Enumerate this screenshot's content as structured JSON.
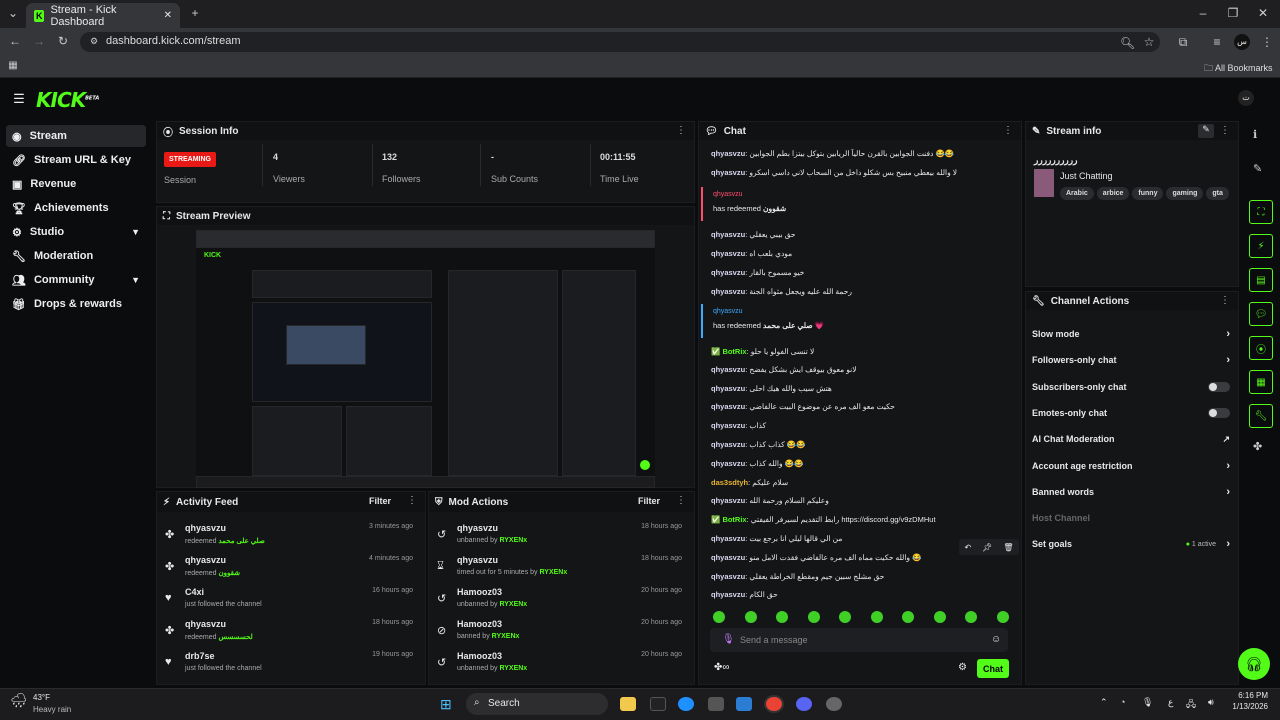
{
  "browser": {
    "tab_title": "Stream - Kick Dashboard",
    "url": "dashboard.kick.com/stream",
    "bookmarks_label": "All Bookmarks",
    "profile_initial": "‫س"
  },
  "app": {
    "logo": "KICK",
    "logo_beta": "BETA",
    "avatar_initial": "ت"
  },
  "sidebar": {
    "items": [
      {
        "label": "Stream",
        "icon": "radio-icon"
      },
      {
        "label": "Stream URL & Key",
        "icon": "link-icon"
      },
      {
        "label": "Revenue",
        "icon": "revenue-icon"
      },
      {
        "label": "Achievements",
        "icon": "trophy-icon"
      },
      {
        "label": "Studio",
        "icon": "studio-icon"
      },
      {
        "label": "Moderation",
        "icon": "wrench-icon"
      },
      {
        "label": "Community",
        "icon": "community-icon"
      },
      {
        "label": "Drops & rewards",
        "icon": "gift-icon"
      }
    ]
  },
  "session": {
    "title": "Session Info",
    "status": "STREAMING",
    "session_label": "Session",
    "viewers": "4",
    "viewers_label": "Viewers",
    "followers": "132",
    "followers_label": "Followers",
    "subs": "-",
    "subs_label": "Sub Counts",
    "time": "00:11:55",
    "time_label": "Time Live"
  },
  "preview": {
    "title": "Stream Preview"
  },
  "activity": {
    "title": "Activity Feed",
    "filter": "Filter",
    "rows": [
      {
        "name": "qhyasvzu",
        "desc": "redeemed",
        "reward": "صلي على محمد",
        "time": "3 minutes ago",
        "icon": "redeem-icon"
      },
      {
        "name": "qhyasvzu",
        "desc": "redeemed",
        "reward": "شقوون",
        "time": "4 minutes ago",
        "icon": "redeem-icon"
      },
      {
        "name": "C4xi",
        "desc": "just followed the channel",
        "reward": "",
        "time": "16 hours ago",
        "icon": "heart-icon"
      },
      {
        "name": "qhyasvzu",
        "desc": "redeemed",
        "reward": "لحسسسس",
        "time": "18 hours ago",
        "icon": "redeem-icon"
      },
      {
        "name": "drb7se",
        "desc": "just followed the channel",
        "reward": "",
        "time": "19 hours ago",
        "icon": "heart-icon"
      }
    ]
  },
  "mod": {
    "title": "Mod Actions",
    "filter": "Filter",
    "rows": [
      {
        "name": "qhyasvzu",
        "desc": "unbanned by",
        "by": "RYXENx",
        "time": "18 hours ago",
        "icon": "undo-icon"
      },
      {
        "name": "qhyasvzu",
        "desc": "timed out for 5 minutes by",
        "by": "RYXENx",
        "time": "18 hours ago",
        "icon": "hourglass-icon"
      },
      {
        "name": "Hamooz03",
        "desc": "unbanned by",
        "by": "RYXENx",
        "time": "20 hours ago",
        "icon": "undo-icon"
      },
      {
        "name": "Hamooz03",
        "desc": "banned by",
        "by": "RYXENx",
        "time": "20 hours ago",
        "icon": "ban-icon"
      },
      {
        "name": "Hamooz03",
        "desc": "unbanned by",
        "by": "RYXENx",
        "time": "20 hours ago",
        "icon": "undo-icon"
      }
    ]
  },
  "chat": {
    "title": "Chat",
    "lines": [
      {
        "user": "qhyasvzu",
        "msg": "دفنت الجوابين بالقرن حالياً الريابين بتوكل بيتزا بطم الجوابين 😂😂"
      },
      {
        "user": "qhyasvzu",
        "msg": "لا والله بيعطي منبيح بس شكلو داخل من السحاب لاني داسي اسكرو"
      },
      {
        "user": "qhyasvzu",
        "msg": "حق بيبي يعقلي"
      },
      {
        "user": "qhyasvzu",
        "msg": "مودي بلعب اه"
      },
      {
        "user": "qhyasvzu",
        "msg": "خيو مسموح بالقار"
      },
      {
        "user": "qhyasvzu",
        "msg": "رحمة الله عليه ويجعل مثواه الجنة"
      },
      {
        "user": "BotRix",
        "msg": "لا تنسى الفولو يا حلو"
      },
      {
        "user": "qhyasvzu",
        "msg": "لانو معوق بيوقف ايش بشكل يفضح"
      },
      {
        "user": "qhyasvzu",
        "msg": "هتش سيب والله هيك احلى"
      },
      {
        "user": "qhyasvzu",
        "msg": "حكيت معو الف مره عن موضوع البيت عالفاضي"
      },
      {
        "user": "qhyasvzu",
        "msg": "كذاب"
      },
      {
        "user": "qhyasvzu",
        "msg": "كذاب كذاب 😂😂"
      },
      {
        "user": "qhyasvzu",
        "msg": "والله كذاب 😂😂"
      },
      {
        "user": "das3sdtyh",
        "msg": "سلام عليكم"
      },
      {
        "user": "qhyasvzu",
        "msg": "وعليكم السلام ورحمة الله"
      },
      {
        "user": "BotRix",
        "msg": "رابط التقديم لسيرفر الفيفتي https://discord.gg/v9zDMHut"
      },
      {
        "user": "qhyasvzu",
        "msg": "من الي قالها ليلي انا برجع بيت"
      },
      {
        "user": "qhyasvzu",
        "msg": "والله حكيت مماه الف مره عالفاضي فقدت الامل منو 😂"
      },
      {
        "user": "qhyasvzu",
        "msg": "حق مشلج سبين جيم ومقطع الخراطة يعقلي"
      },
      {
        "user": "qhyasvzu",
        "msg": "حق الكام"
      }
    ],
    "redeem1": {
      "user": "qhyasvzu",
      "text": "has redeemed",
      "reward": "شقوون"
    },
    "redeem2": {
      "user": "qhyasvzu",
      "text": "has redeemed",
      "reward": "صلي على محمد 💗"
    },
    "placeholder": "Send a message",
    "send": "Chat"
  },
  "stream_info": {
    "title": "Stream info",
    "stream_title": "رررررررررر",
    "category": "Just Chatting",
    "tags": [
      "Arabic",
      "arbice",
      "funny",
      "gaming",
      "gta"
    ]
  },
  "actions": {
    "title": "Channel Actions",
    "items": [
      {
        "label": "Slow mode",
        "ctl": "arrow"
      },
      {
        "label": "Followers-only chat",
        "ctl": "arrow"
      },
      {
        "label": "Subscribers-only chat",
        "ctl": "toggle"
      },
      {
        "label": "Emotes-only chat",
        "ctl": "toggle"
      },
      {
        "label": "AI Chat Moderation",
        "ctl": "ext"
      },
      {
        "label": "Account age restriction",
        "ctl": "arrow"
      },
      {
        "label": "Banned words",
        "ctl": "arrow"
      },
      {
        "label": "Host Channel",
        "ctl": "none"
      },
      {
        "label": "Set goals",
        "ctl": "arrow"
      }
    ],
    "goals_status": "1 active"
  },
  "taskbar": {
    "weather_temp": "43°F",
    "weather_desc": "Heavy rain",
    "search": "Search",
    "time": "6:16 PM",
    "date": "1/13/2026"
  },
  "colors": {
    "accent": "#53fc18",
    "live": "#e91916",
    "bg": "#0b0c0e"
  }
}
